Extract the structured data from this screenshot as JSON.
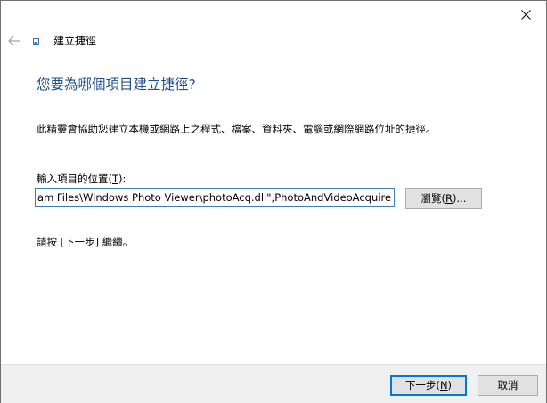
{
  "window": {
    "close_icon": "close-icon"
  },
  "header": {
    "back_icon": "back-arrow-icon",
    "app_icon": "shortcut-icon",
    "title": "建立捷徑"
  },
  "main": {
    "heading": "您要為哪個項目建立捷徑?",
    "description": "此精靈會協助您建立本機或網路上之程式、檔案、資料夾、電腦或網際網路位址的捷徑。",
    "location_label_prefix": "輸入項目的位置(",
    "location_label_key": "T",
    "location_label_suffix": "):",
    "location_value": "am Files\\Windows Photo Viewer\\photoAcq.dll\",PhotoAndVideoAcquire",
    "browse_label_prefix": "瀏覽(",
    "browse_label_key": "R",
    "browse_label_suffix": ")...",
    "hint": "請按 [下一步] 繼續。"
  },
  "footer": {
    "next_label_prefix": "下一步(",
    "next_label_key": "N",
    "next_label_suffix": ")",
    "cancel_label": "取消"
  },
  "colors": {
    "heading": "#1f4e8c",
    "focus_border": "#0078d7",
    "input_border": "#3c7fb1",
    "footer_bg": "#f0f0f0",
    "button_bg": "#e1e1e1"
  }
}
